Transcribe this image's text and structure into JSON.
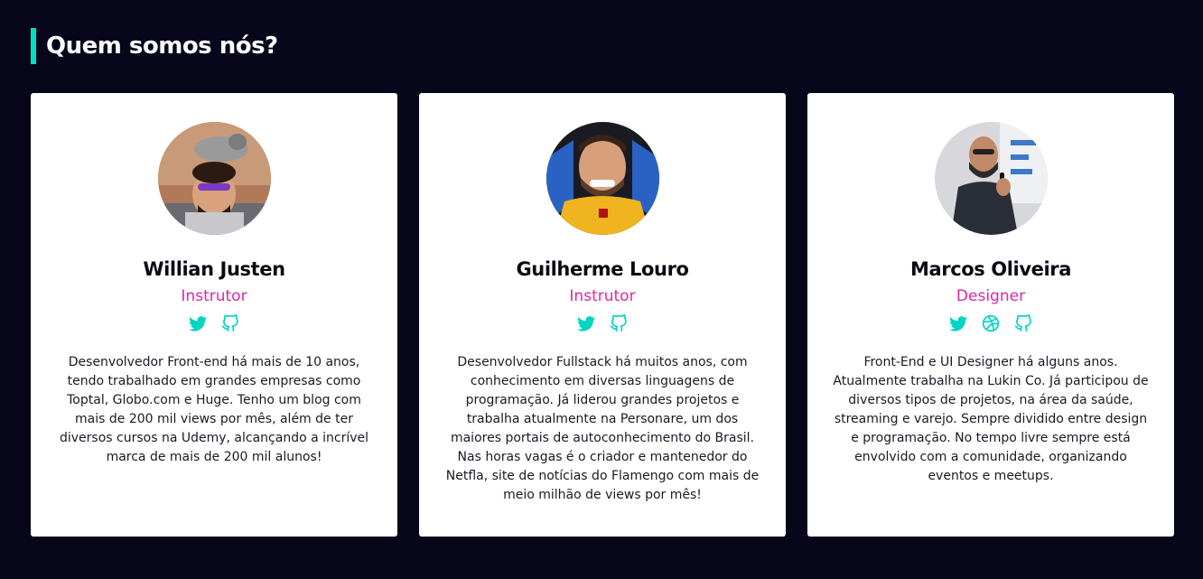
{
  "section": {
    "title": "Quem somos nós?"
  },
  "colors": {
    "background": "#07061a",
    "accent": "#00e0c0",
    "role": "#e024a8"
  },
  "members": [
    {
      "name": "Willian Justen",
      "role": "Instrutor",
      "socials": [
        "twitter-icon",
        "github-icon"
      ],
      "bio": "Desenvolvedor Front-end há mais de 10 anos, tendo trabalhado em grandes empresas como Toptal, Globo.com e Huge. Tenho um blog com mais de 200 mil views por mês, além de ter diversos cursos na Udemy, alcançando a incrível marca de mais de 200 mil alunos!"
    },
    {
      "name": "Guilherme Louro",
      "role": "Instrutor",
      "socials": [
        "twitter-icon",
        "github-icon"
      ],
      "bio": "Desenvolvedor Fullstack há muitos anos, com conhecimento em diversas linguagens de programação. Já liderou grandes projetos e trabalha atualmente na Personare, um dos maiores portais de autoconhecimento do Brasil. Nas horas vagas é o criador e mantenedor do Netfla, site de notícias do Flamengo com mais de meio milhão de views por mês!"
    },
    {
      "name": "Marcos Oliveira",
      "role": "Designer",
      "socials": [
        "twitter-icon",
        "dribbble-icon",
        "github-icon"
      ],
      "bio": "Front-End e UI Designer há alguns anos. Atualmente trabalha na Lukin Co. Já participou de diversos tipos de projetos, na área da saúde, streaming e varejo. Sempre dividido entre design e programação. No tempo livre sempre está envolvido com a comunidade, organizando eventos e meetups."
    }
  ]
}
